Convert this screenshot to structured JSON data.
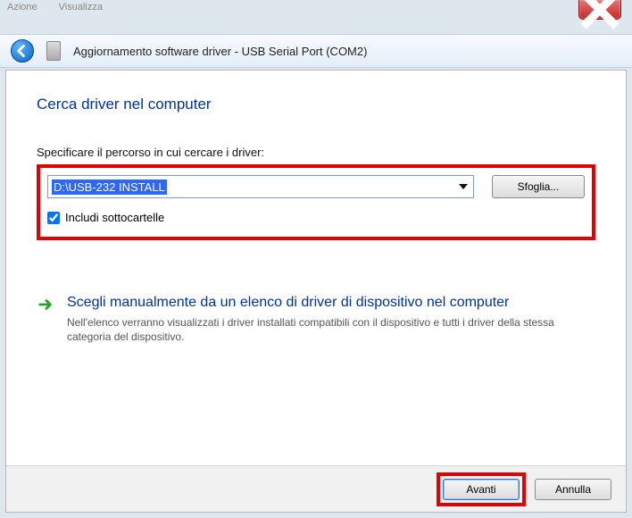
{
  "bgTabs": [
    "Azione",
    "Visualizza"
  ],
  "nav": {
    "title": "Aggiornamento software driver - USB Serial Port (COM2)"
  },
  "page": {
    "heading": "Cerca driver nel computer",
    "pathLabel": "Specificare il percorso in cui cercare i driver:",
    "pathValue": "D:\\USB-232 INSTALL",
    "browse": "Sfoglia...",
    "includeSub": "Includi sottocartelle",
    "includeSubChecked": true,
    "option": {
      "title": "Scegli manualmente da un elenco di driver di dispositivo nel computer",
      "sub": "Nell'elenco verranno visualizzati i driver installati compatibili con il dispositivo e tutti i driver della stessa categoria del dispositivo."
    }
  },
  "footer": {
    "next": "Avanti",
    "cancel": "Annulla"
  }
}
